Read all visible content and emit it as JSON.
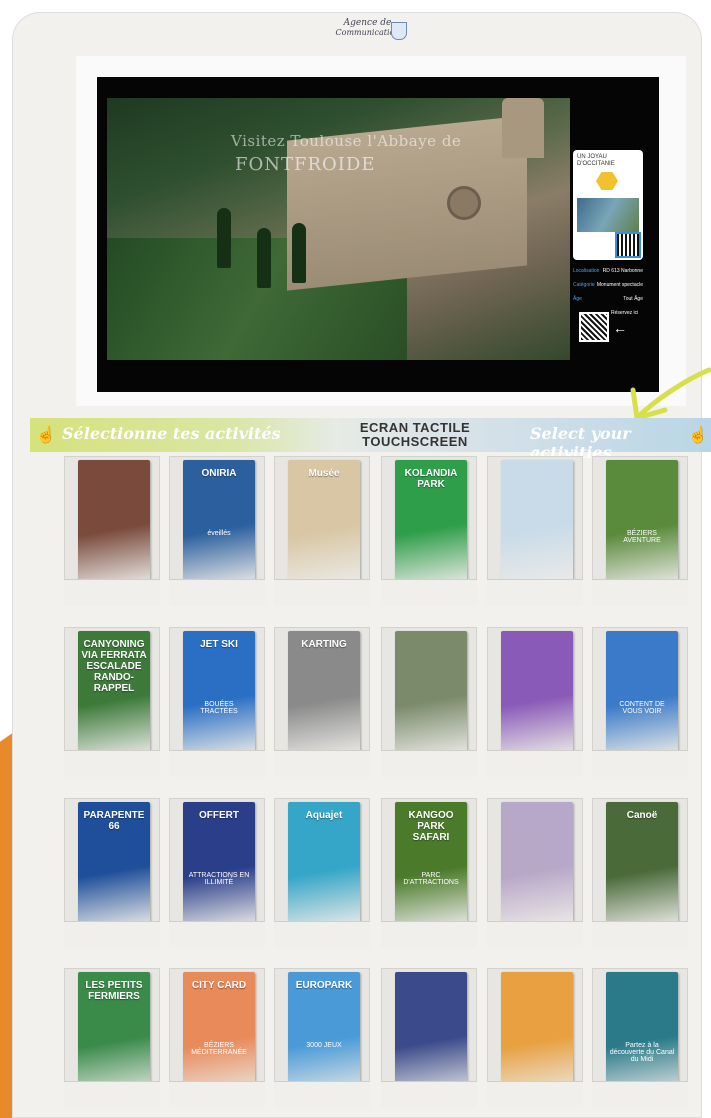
{
  "header": {
    "logo_line1": "Agence de",
    "logo_line2": "Communication",
    "logo_mark": "Virus"
  },
  "screen": {
    "video_title_line1": "Visitez Toulouse l'Abbaye de",
    "video_title_line2": "FONTFROIDE",
    "card_title": "UN JOYAU D'OCCITANIE",
    "info": [
      {
        "key": "Localisation",
        "value": "RD 613 Narbonne"
      },
      {
        "key": "Catégorie",
        "value": "Monument spectacle"
      },
      {
        "key": "Âge",
        "value": "Tout Âge"
      }
    ],
    "reserve_label": "Réservez ici"
  },
  "banner": {
    "left": "Sélectionne tes activités",
    "center_line1": "ECRAN TACTILE",
    "center_line2": "TOUCHSCREEN",
    "right": "Select your activities"
  },
  "colors": {
    "accent_orange": "#e8892b",
    "accent_yellow": "#d7e04a",
    "screen_blue": "#3c8cd8"
  },
  "brochures": [
    {
      "title": "",
      "subtitle": "",
      "color": "#7a4a3c"
    },
    {
      "title": "ONIRIA",
      "subtitle": "éveillés",
      "color": "#2b5f9e"
    },
    {
      "title": "Musée",
      "subtitle": "",
      "color": "#d8c6a4"
    },
    {
      "title": "KOLANDIA PARK",
      "subtitle": "",
      "color": "#2f9e4a"
    },
    {
      "title": "",
      "subtitle": "",
      "color": "#c9dbe8"
    },
    {
      "title": "",
      "subtitle": "BÉZIERS AVENTURE",
      "color": "#5a8a3c"
    },
    {
      "title": "CANYONING VIA FERRATA ESCALADE RANDO-RAPPEL",
      "subtitle": "",
      "color": "#3d7a3a"
    },
    {
      "title": "JET SKI",
      "subtitle": "BOUÉES TRACTÉES",
      "color": "#2a6fc4"
    },
    {
      "title": "KARTING",
      "subtitle": "",
      "color": "#8a8a8a"
    },
    {
      "title": "",
      "subtitle": "",
      "color": "#7a8a6a"
    },
    {
      "title": "",
      "subtitle": "",
      "color": "#8a5ab8"
    },
    {
      "title": "",
      "subtitle": "CONTENT DE VOUS VOIR",
      "color": "#3a7ac8"
    },
    {
      "title": "PARAPENTE 66",
      "subtitle": "",
      "color": "#1f4f9a"
    },
    {
      "title": "OFFERT",
      "subtitle": "ATTRACTIONS EN ILLIMITÉ",
      "color": "#2a3e8a"
    },
    {
      "title": "Aquajet",
      "subtitle": "",
      "color": "#36a6c8"
    },
    {
      "title": "KANGOO PARK SAFARI",
      "subtitle": "PARC D'ATTRACTIONS",
      "color": "#4a7a2a"
    },
    {
      "title": "",
      "subtitle": "",
      "color": "#b8a8c8"
    },
    {
      "title": "Canoë",
      "subtitle": "",
      "color": "#4a6a3a"
    },
    {
      "title": "LES PETITS FERMIERS",
      "subtitle": "",
      "color": "#3a8a4a"
    },
    {
      "title": "CITY CARD",
      "subtitle": "BÉZIERS MÉDITERRANÉE",
      "color": "#e88a5a"
    },
    {
      "title": "EUROPARK",
      "subtitle": "3000 JEUX",
      "color": "#4a9ad8"
    },
    {
      "title": "",
      "subtitle": "",
      "color": "#3a4a8a"
    },
    {
      "title": "",
      "subtitle": "",
      "color": "#e8a040"
    },
    {
      "title": "",
      "subtitle": "Partez à la découverte du Canal du Midi",
      "color": "#2a7a8a"
    }
  ]
}
